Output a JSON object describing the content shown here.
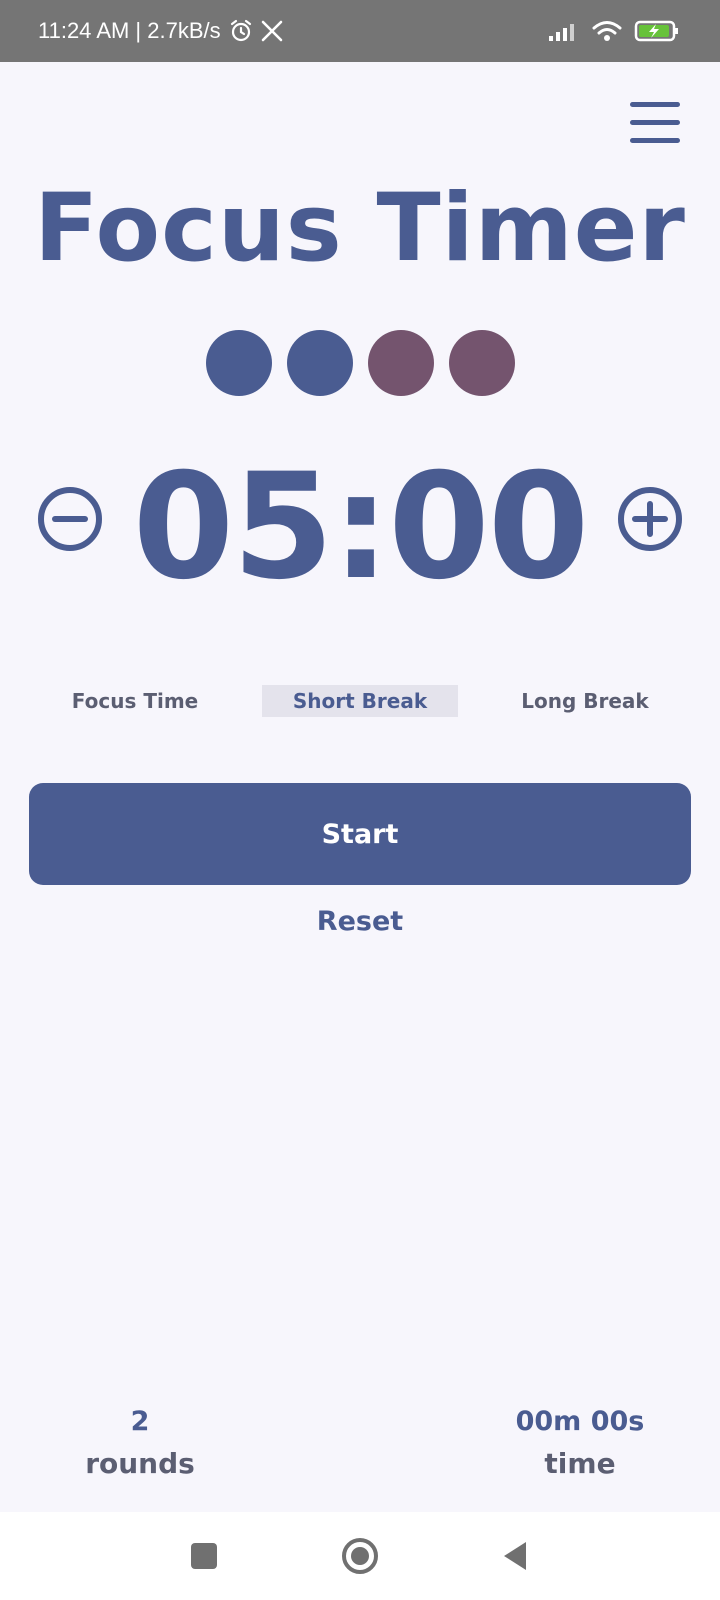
{
  "status_bar": {
    "time_speed": "11:24 AM | 2.7kB/s",
    "icons": [
      "alarm-icon",
      "x-logo-icon",
      "signal-icon",
      "wifi-icon",
      "battery-charging-icon"
    ]
  },
  "header": {
    "menu_icon": "hamburger-menu-icon",
    "title": "Focus Timer"
  },
  "round_indicators": [
    {
      "state": "completed",
      "color": "#4a5c91"
    },
    {
      "state": "completed",
      "color": "#4a5c91"
    },
    {
      "state": "pending",
      "color": "#74546e"
    },
    {
      "state": "pending",
      "color": "#74546e"
    }
  ],
  "timer": {
    "display": "05:00",
    "decrease_icon": "minus-circle-icon",
    "increase_icon": "plus-circle-icon"
  },
  "modes": [
    {
      "label": "Focus Time",
      "active": false
    },
    {
      "label": "Short Break",
      "active": true
    },
    {
      "label": "Long Break",
      "active": false
    }
  ],
  "actions": {
    "start_label": "Start",
    "reset_label": "Reset"
  },
  "stats": {
    "rounds_value": "2",
    "rounds_label": "rounds",
    "time_value": "00m 00s",
    "time_label": "time"
  },
  "nav_bar": {
    "icons": [
      "recents-square-icon",
      "home-circle-icon",
      "back-triangle-icon"
    ]
  },
  "colors": {
    "primary": "#4a5c91",
    "secondary": "#74546e",
    "background": "#f7f6fc",
    "text_muted": "#5b5e72",
    "active_tab_bg": "#e4e3ec"
  }
}
